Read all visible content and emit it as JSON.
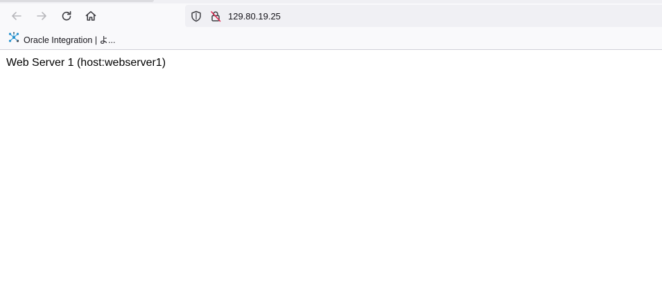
{
  "toolbar": {
    "back_icon": "arrow-left-icon",
    "forward_icon": "arrow-right-icon",
    "reload_icon": "reload-icon",
    "home_icon": "home-icon"
  },
  "urlbar": {
    "url": "129.80.19.25",
    "tracking_protection_icon": "shield-icon",
    "connection_icon": "insecure-lock-icon"
  },
  "bookmarks": [
    {
      "label": "Oracle Integration | よ...",
      "icon": "oracle-integration-icon"
    }
  ],
  "page": {
    "text": "Web Server 1 (host:webserver1)"
  },
  "colors": {
    "toolbar_bg": "#f9f9fb",
    "urlbar_bg": "#f0f0f4",
    "icon_disabled": "#b8b8bc",
    "icon_active": "#3d3d42",
    "insecure_slash": "#e22850",
    "bookmark_icon_accent": "#1f8fce"
  }
}
